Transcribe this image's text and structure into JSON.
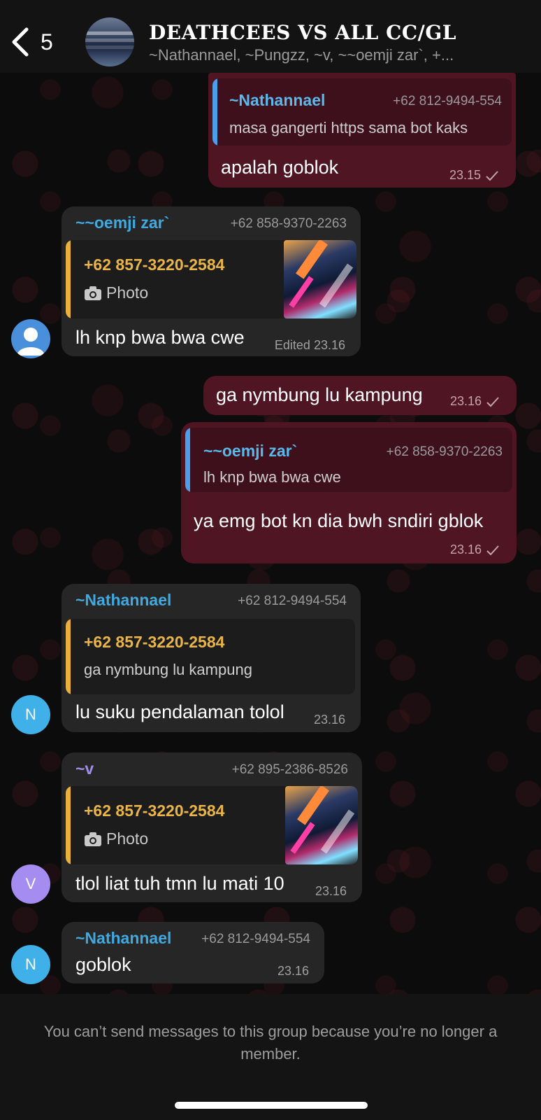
{
  "header": {
    "back_count": "5",
    "title": "DEATHCEES VS ALL CC/GL",
    "members": "~Nathannael, ~Pungzz, ~v, ~~oemji zar`, +..."
  },
  "messages": [
    {
      "direction": "outgoing",
      "quote": {
        "name": "~Nathannael",
        "phone": "+62 812-9494-554",
        "text": "masa gangerti https sama bot kaks"
      },
      "text": "apalah goblok",
      "time": "23.15"
    },
    {
      "direction": "incoming",
      "sender": "~~oemji zar`",
      "phone": "+62 858-9370-2263",
      "quote": {
        "name": "+62 857-3220-2584",
        "text": "Photo"
      },
      "text": "lh knp bwa bwa cwe",
      "time": "Edited 23.16"
    },
    {
      "direction": "outgoing",
      "text": "ga nymbung lu kampung",
      "time": "23.16"
    },
    {
      "direction": "outgoing",
      "quote": {
        "name": "~~oemji zar`",
        "phone": "+62 858-9370-2263",
        "text": "lh knp bwa bwa cwe"
      },
      "text": "ya emg bot kn dia bwh sndiri gblok",
      "time": "23.16"
    },
    {
      "direction": "incoming",
      "sender": "~Nathannael",
      "phone": "+62 812-9494-554",
      "avatar": "N",
      "quote": {
        "name": "+62 857-3220-2584",
        "text": "ga nymbung lu kampung"
      },
      "text": "lu suku pendalaman tolol",
      "time": "23.16"
    },
    {
      "direction": "incoming",
      "sender": "~v",
      "phone": "+62 895-2386-8526",
      "avatar": "V",
      "quote": {
        "name": "+62 857-3220-2584",
        "text": "Photo"
      },
      "text": "tlol liat tuh tmn lu mati 10",
      "time": "23.16"
    },
    {
      "direction": "incoming",
      "sender": "~Nathannael",
      "phone": "+62 812-9494-554",
      "avatar": "N",
      "text": "goblok",
      "time": "23.16"
    }
  ],
  "footer": {
    "notice": "You can’t send messages to this group because you’re no longer a member."
  },
  "colors": {
    "outgoing_bubble": "#4f1523",
    "incoming_bubble": "#262626",
    "quote_bar_blue": "#4a9fe8",
    "quote_bar_yellow": "#e7b13c"
  },
  "icons": [
    "chevron-left-icon",
    "camera-icon",
    "checkmark-icon",
    "default-avatar-icon"
  ]
}
